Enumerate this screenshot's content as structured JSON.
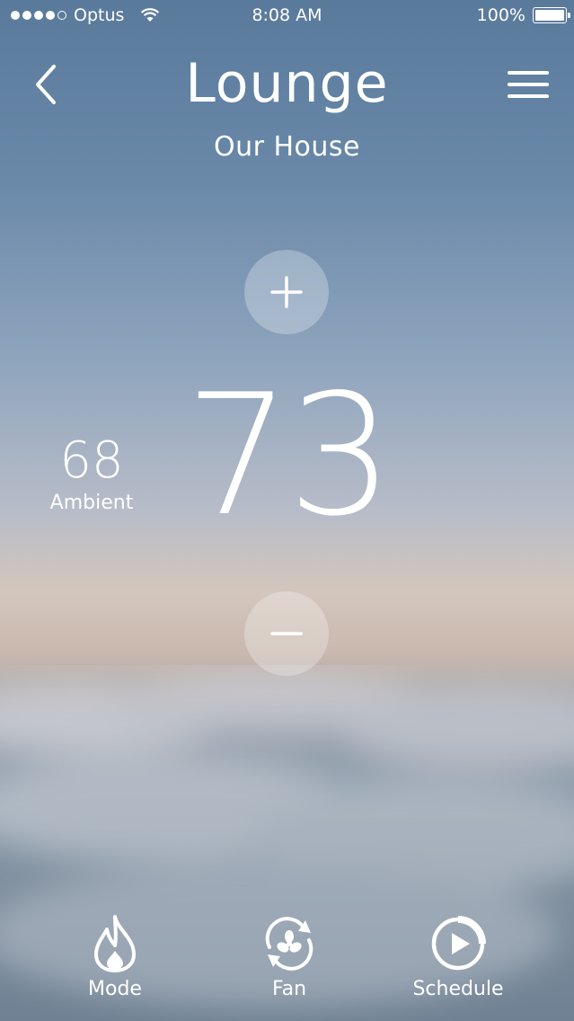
{
  "status_bar": {
    "carrier": "Optus",
    "time": "8:08 AM",
    "battery": "100%",
    "signal_bars": 4,
    "signal_max": 5
  },
  "header": {
    "title": "Lounge",
    "subtitle": "Our House",
    "back_icon": "chevron-left-icon",
    "menu_icon": "hamburger-menu-icon"
  },
  "thermostat": {
    "setpoint": "73",
    "ambient_value": "68",
    "ambient_label": "Ambient",
    "increase_icon": "plus-icon",
    "decrease_icon": "minus-icon"
  },
  "tabs": [
    {
      "label": "Mode",
      "icon": "flame-icon"
    },
    {
      "label": "Fan",
      "icon": "fan-icon"
    },
    {
      "label": "Schedule",
      "icon": "play-circle-icon"
    }
  ],
  "colors": {
    "foreground": "#ffffff",
    "button_overlay": "rgba(255,255,255,0.28)"
  }
}
